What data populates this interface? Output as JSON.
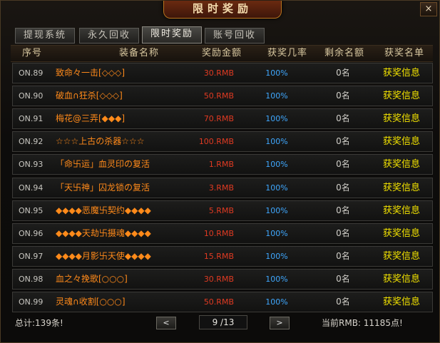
{
  "window": {
    "title": "限时奖励",
    "close_glyph": "×"
  },
  "tabs": [
    {
      "label": "提现系统",
      "active": false
    },
    {
      "label": "永久回收",
      "active": false
    },
    {
      "label": "限时奖励",
      "active": true
    },
    {
      "label": "账号回收",
      "active": false
    }
  ],
  "table": {
    "headers": [
      "序号",
      "装备名称",
      "奖励金额",
      "获奖几率",
      "剩余名额",
      "获奖名单"
    ],
    "rows": [
      {
        "no": "ON.89",
        "name": "致命々一击[◇◇◇]",
        "amount": "30.RMB",
        "rate": "100%",
        "remaining": "0名",
        "winners": "获奖信息"
      },
      {
        "no": "ON.90",
        "name": "破血∩狂杀[◇◇◇]",
        "amount": "50.RMB",
        "rate": "100%",
        "remaining": "0名",
        "winners": "获奖信息"
      },
      {
        "no": "ON.91",
        "name": "梅花@三弄[◆◆◆]",
        "amount": "70.RMB",
        "rate": "100%",
        "remaining": "0名",
        "winners": "获奖信息"
      },
      {
        "no": "ON.92",
        "name": "☆☆☆上古の杀器☆☆☆",
        "amount": "100.RMB",
        "rate": "100%",
        "remaining": "0名",
        "winners": "获奖信息"
      },
      {
        "no": "ON.93",
        "name": "「命卐运」血灵印の复活",
        "amount": "1.RMB",
        "rate": "100%",
        "remaining": "0名",
        "winners": "获奖信息"
      },
      {
        "no": "ON.94",
        "name": "「天卐神」囚龙锁の复活",
        "amount": "3.RMB",
        "rate": "100%",
        "remaining": "0名",
        "winners": "获奖信息"
      },
      {
        "no": "ON.95",
        "name": "◆◆◆◆恶魔卐契约◆◆◆◆",
        "amount": "5.RMB",
        "rate": "100%",
        "remaining": "0名",
        "winners": "获奖信息"
      },
      {
        "no": "ON.96",
        "name": "◆◆◆◆天劫卐摄魂◆◆◆◆",
        "amount": "10.RMB",
        "rate": "100%",
        "remaining": "0名",
        "winners": "获奖信息"
      },
      {
        "no": "ON.97",
        "name": "◆◆◆◆月影卐天使◆◆◆◆",
        "amount": "15.RMB",
        "rate": "100%",
        "remaining": "0名",
        "winners": "获奖信息"
      },
      {
        "no": "ON.98",
        "name": "血之々挽歌[○○○]",
        "amount": "30.RMB",
        "rate": "100%",
        "remaining": "0名",
        "winners": "获奖信息"
      },
      {
        "no": "ON.99",
        "name": "灵魂∩收割[○○○]",
        "amount": "50.RMB",
        "rate": "100%",
        "remaining": "0名",
        "winners": "获奖信息"
      }
    ]
  },
  "footer": {
    "total": "总计:139条!",
    "prev_glyph": "<",
    "next_glyph": ">",
    "page": "9 /13",
    "rmb": "当前RMB: 11185点!"
  },
  "colors": {
    "name": "#ff8a1a",
    "amount": "#e03a22",
    "rate": "#3fa8ff",
    "winners": "#f4e400"
  }
}
